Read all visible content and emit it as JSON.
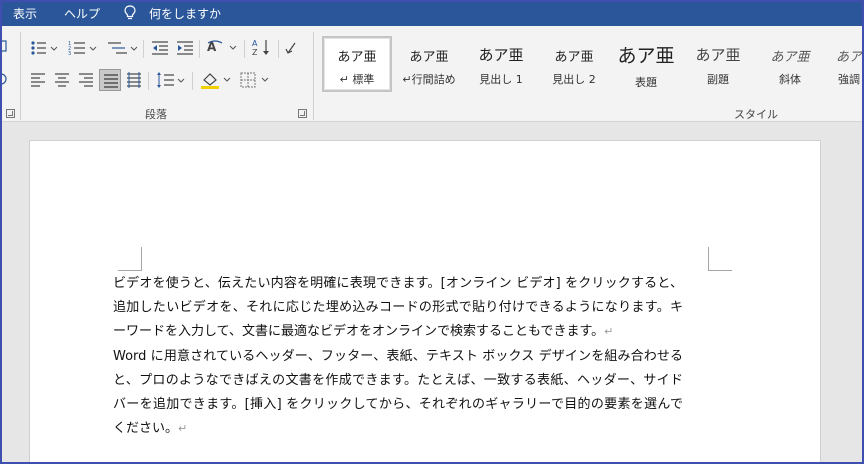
{
  "menubar": {
    "items": [
      "表示",
      "ヘルプ"
    ],
    "tell_me": "何をしますか"
  },
  "ribbon": {
    "paragraph_group_label": "段落",
    "styles_group_label": "スタイル",
    "styles": [
      {
        "sample": "あア亜",
        "name": "標準",
        "selected": true
      },
      {
        "sample": "あア亜",
        "name": "行間詰め",
        "selected": false
      },
      {
        "sample": "あア亜",
        "name": "見出し 1",
        "selected": false
      },
      {
        "sample": "あア亜",
        "name": "見出し 2",
        "selected": false
      },
      {
        "sample": "あア亜",
        "name": "表題",
        "selected": false
      },
      {
        "sample": "あア亜",
        "name": "副題",
        "selected": false
      },
      {
        "sample": "あア亜",
        "name": "斜体",
        "selected": false
      },
      {
        "sample": "あア亜",
        "name": "強調",
        "selected": false
      }
    ],
    "style_marker": "↵"
  },
  "document": {
    "paragraph1": "ビデオを使うと、伝えたい内容を明確に表現できます。[オンライン ビデオ] をクリックすると、追加したいビデオを、それに応じた埋め込みコードの形式で貼り付けできるようになります。キーワードを入力して、文書に最適なビデオをオンラインで検索することもできます。",
    "paragraph2": "Word に用意されているヘッダー、フッター、表紙、テキスト ボックス デザインを組み合わせると、プロのようなできばえの文書を作成できます。たとえば、一致する表紙、ヘッダー、サイドバーを追加できます。[挿入] をクリックしてから、それぞれのギャラリーで目的の要素を選んでください。",
    "paragraph_mark": "↵"
  },
  "colors": {
    "title_bar": "#2b579a",
    "ribbon_bg": "#f3f3f3",
    "doc_bg": "#e6e6e6",
    "frame": "#3f4fb0"
  }
}
